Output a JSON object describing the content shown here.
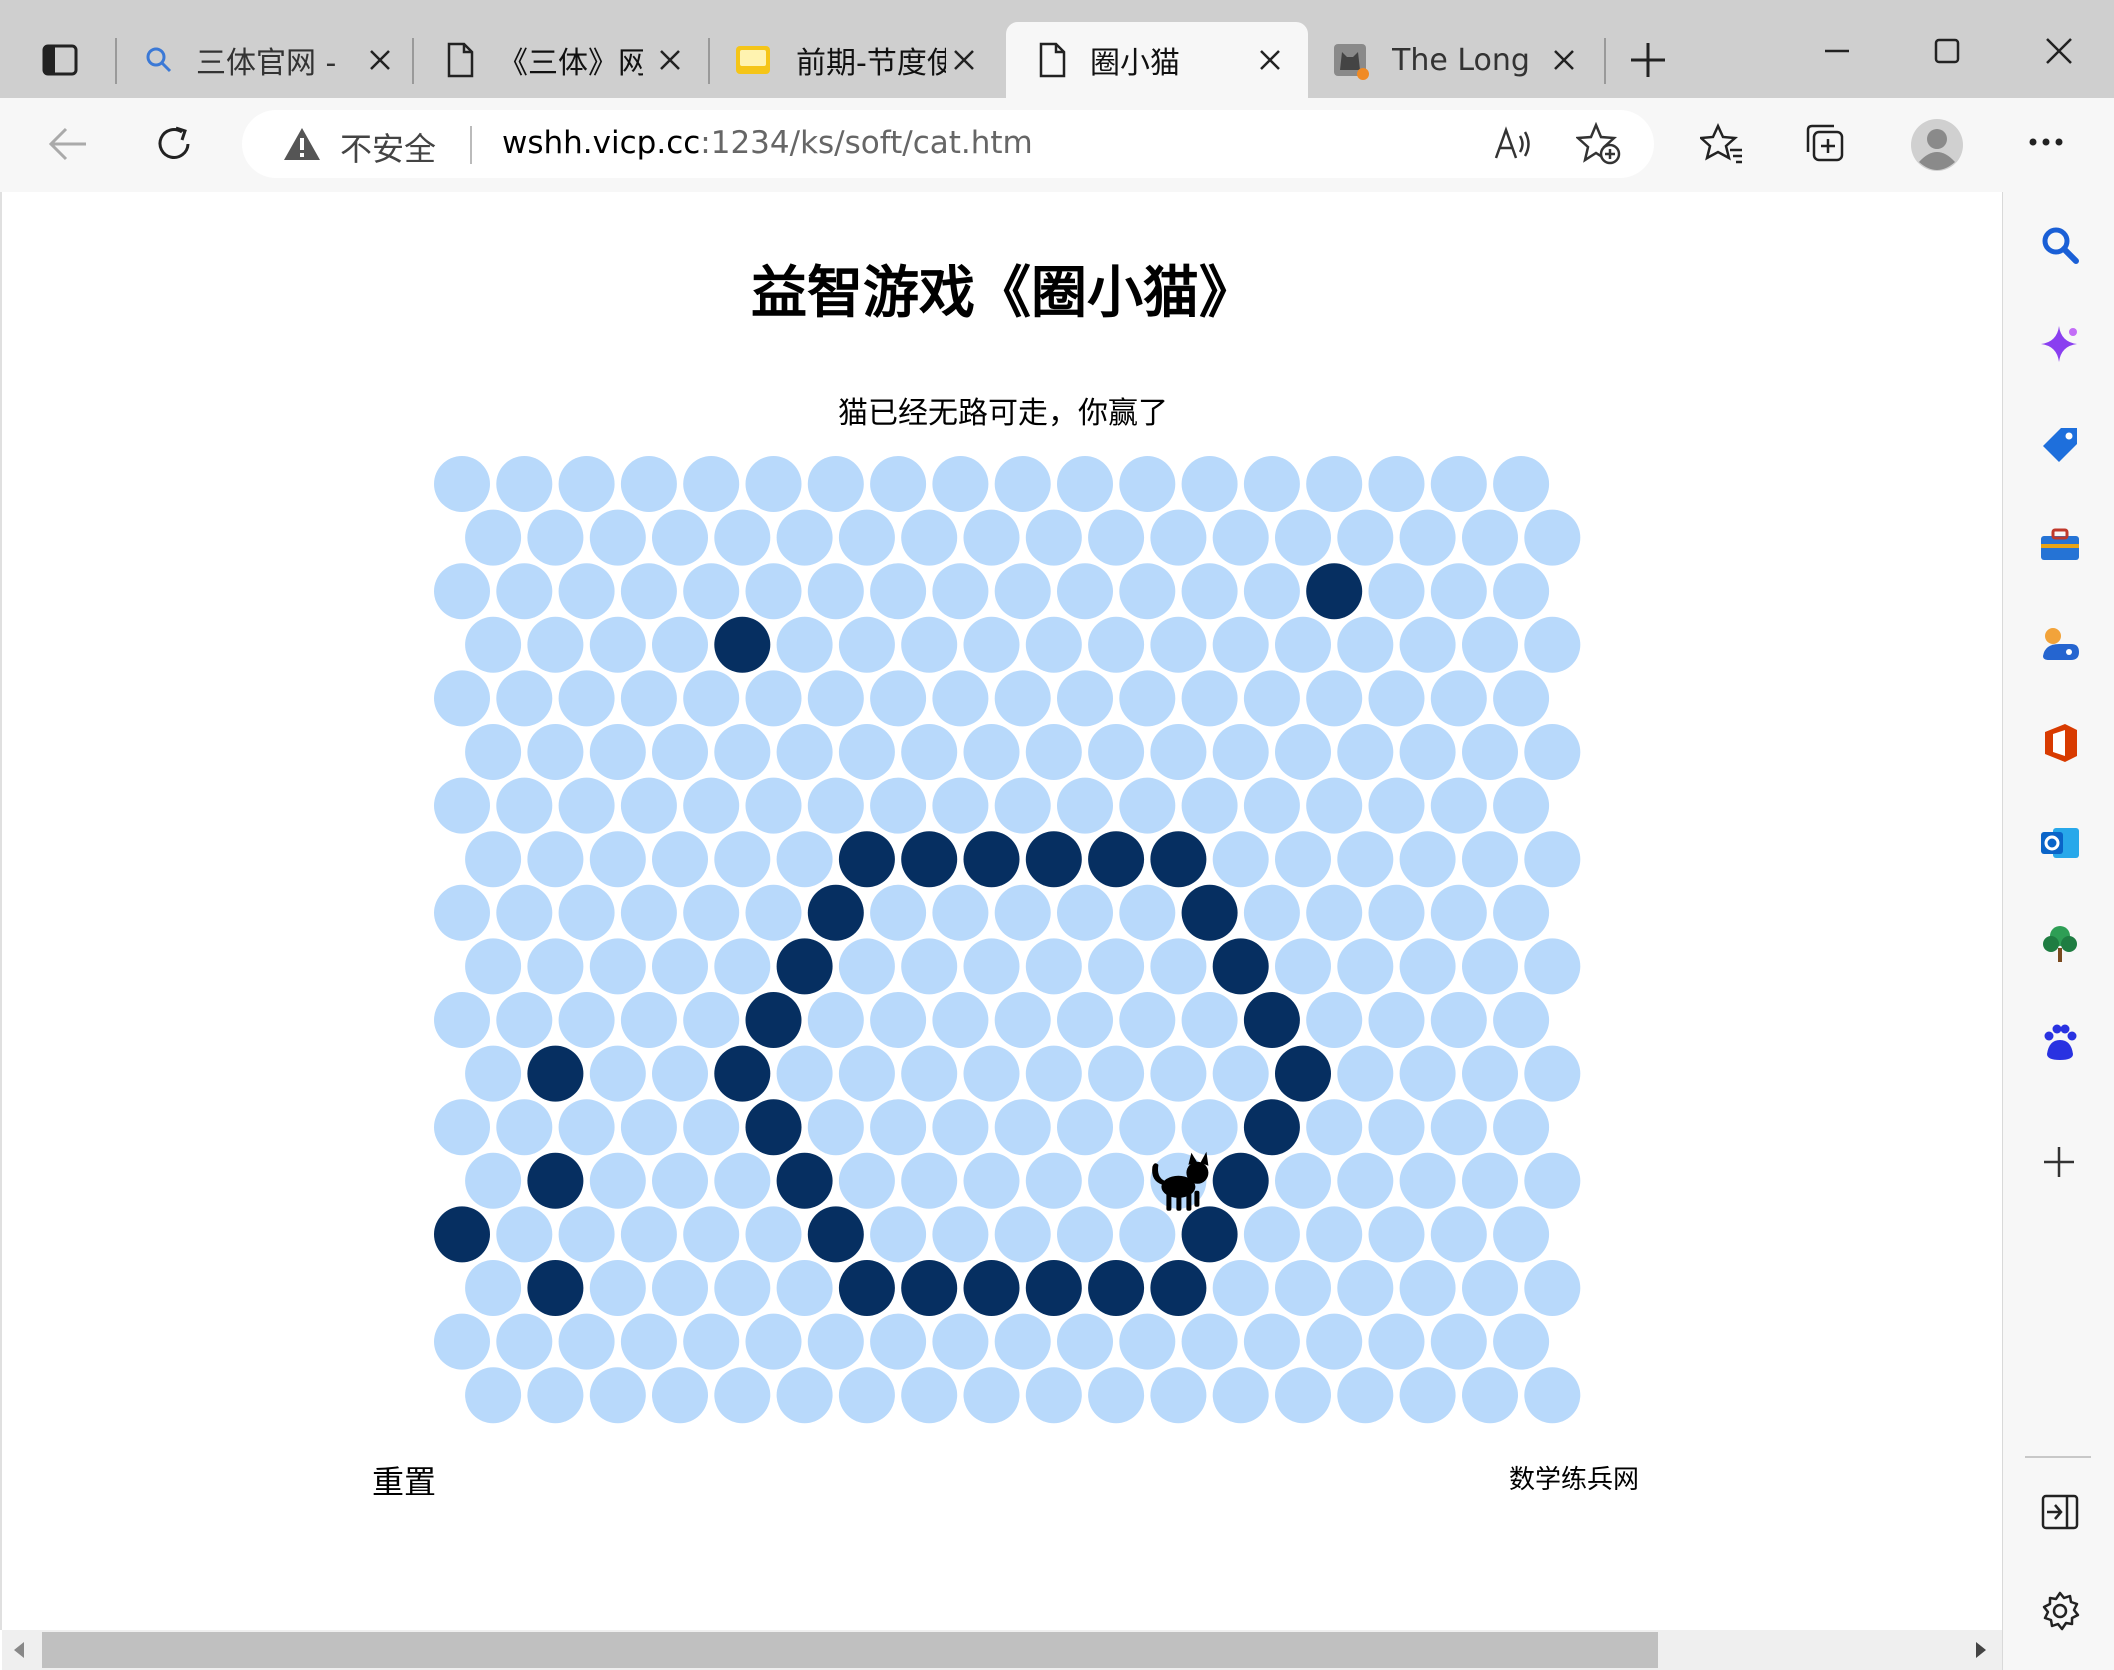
{
  "browser": {
    "tabs": [
      {
        "title": "三体官网 -",
        "icon": "search-icon"
      },
      {
        "title": "《三体》网",
        "icon": "page-icon"
      },
      {
        "title": "前期-节度使",
        "icon": "folder-icon"
      },
      {
        "title": "圈小猫",
        "icon": "page-icon",
        "active": true
      },
      {
        "title": "The Long D",
        "icon": "cat-avatar-icon"
      }
    ],
    "security_label": "不安全",
    "url_host": "wshh.vicp.cc",
    "url_rest": ":1234/ks/soft/cat.htm"
  },
  "game": {
    "title": "益智游戏《圈小猫》",
    "status": "猫已经无路可走，你赢了",
    "reset_label": "重置",
    "credit": "数学练兵网",
    "rows": 18,
    "cols": 18,
    "blocked": [
      [
        2,
        14
      ],
      [
        3,
        4
      ],
      [
        7,
        6
      ],
      [
        7,
        7
      ],
      [
        7,
        8
      ],
      [
        7,
        9
      ],
      [
        7,
        10
      ],
      [
        7,
        11
      ],
      [
        8,
        6
      ],
      [
        8,
        12
      ],
      [
        9,
        5
      ],
      [
        9,
        12
      ],
      [
        10,
        5
      ],
      [
        10,
        13
      ],
      [
        11,
        1
      ],
      [
        11,
        4
      ],
      [
        11,
        13
      ],
      [
        12,
        5
      ],
      [
        12,
        13
      ],
      [
        13,
        1
      ],
      [
        13,
        5
      ],
      [
        13,
        12
      ],
      [
        14,
        0
      ],
      [
        14,
        6
      ],
      [
        14,
        12
      ],
      [
        15,
        1
      ],
      [
        15,
        6
      ],
      [
        15,
        7
      ],
      [
        15,
        8
      ],
      [
        15,
        9
      ],
      [
        15,
        10
      ],
      [
        15,
        11
      ]
    ],
    "cat": [
      13,
      11
    ],
    "colors": {
      "open": "#b8d9fb",
      "blocked": "#062f61",
      "cat": "#000000"
    }
  },
  "sidebar": {
    "icons": [
      "search-icon",
      "copilot-icon",
      "shopping-tag-icon",
      "tools-icon",
      "games-icon",
      "office-icon",
      "outlook-icon",
      "tree-icon",
      "baidu-icon",
      "add-icon",
      "split-screen-icon",
      "settings-icon"
    ]
  }
}
